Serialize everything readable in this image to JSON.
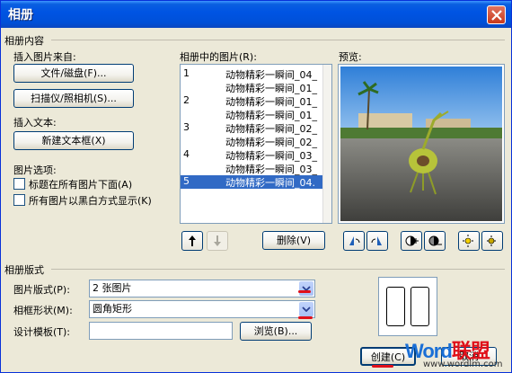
{
  "window": {
    "title": "相册"
  },
  "album_content": {
    "section_label": "相册内容",
    "insert_from_label": "插入图片来自:",
    "file_disk_button": "文件/磁盘(F)...",
    "scanner_camera_button": "扫描仪/照相机(S)...",
    "insert_text_label": "插入文本:",
    "new_textbox_button": "新建文本框(X)",
    "picture_options_label": "图片选项:",
    "option_captions": "标题在所有图片下面(A)",
    "option_bw": "所有图片以黑白方式显示(K)"
  },
  "pictures_list": {
    "label": "相册中的图片(R):",
    "rows": [
      {
        "num": "1",
        "name": "动物精彩一瞬间_04_"
      },
      {
        "num": "",
        "name": "动物精彩一瞬间_01_"
      },
      {
        "num": "2",
        "name": "动物精彩一瞬间_01_"
      },
      {
        "num": "",
        "name": "动物精彩一瞬间_01_"
      },
      {
        "num": "3",
        "name": "动物精彩一瞬间_02_"
      },
      {
        "num": "",
        "name": "动物精彩一瞬间_02_"
      },
      {
        "num": "4",
        "name": "动物精彩一瞬间_03_"
      },
      {
        "num": "",
        "name": "动物精彩一瞬间_03_"
      },
      {
        "num": "5",
        "name": "动物精彩一瞬间_04."
      }
    ],
    "selected_row": "8",
    "delete_button": "删除(V)"
  },
  "preview": {
    "label": "预览:"
  },
  "album_layout": {
    "section_label": "相册版式",
    "picture_layout_label": "图片版式(P):",
    "picture_layout_value": "2 张图片",
    "frame_shape_label": "相框形状(M):",
    "frame_shape_value": "圆角矩形",
    "design_template_label": "设计模板(T):",
    "design_template_value": "",
    "browse_button": "浏览(B)..."
  },
  "footer": {
    "create_button": "创建(C)",
    "cancel_button": "取消"
  },
  "watermark": {
    "brand_word": "Word",
    "brand_cn": "联盟",
    "url": "www.wordlm.com"
  },
  "colors": {
    "title_bar": "#0054e3",
    "selection": "#316ac5",
    "annotation_red": "#e0101a",
    "dialog_bg": "#ece9d8"
  }
}
